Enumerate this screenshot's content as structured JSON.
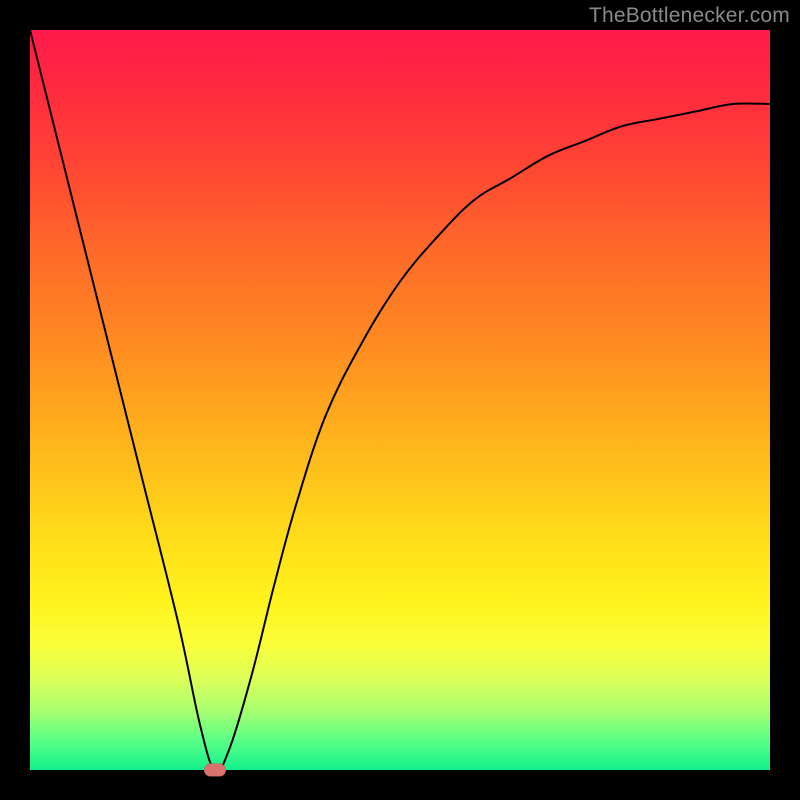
{
  "watermark": "TheBottlenecker.com",
  "chart_data": {
    "type": "line",
    "title": "",
    "xlabel": "",
    "ylabel": "",
    "xlim": [
      0,
      100
    ],
    "ylim": [
      0,
      100
    ],
    "series": [
      {
        "name": "bottleneck-curve",
        "x": [
          0,
          5,
          10,
          15,
          20,
          23,
          25,
          27,
          30,
          33,
          36,
          40,
          45,
          50,
          55,
          60,
          65,
          70,
          75,
          80,
          85,
          90,
          95,
          100
        ],
        "values": [
          100,
          80,
          60,
          40,
          20,
          6,
          0,
          3,
          13,
          25,
          36,
          48,
          58,
          66,
          72,
          77,
          80,
          83,
          85,
          87,
          88,
          89,
          90,
          90
        ]
      }
    ],
    "marker": {
      "x": 25,
      "y": 0
    },
    "gradient_stops": [
      {
        "pos": 0,
        "color": "#ff1a4b"
      },
      {
        "pos": 50,
        "color": "#ffb000"
      },
      {
        "pos": 80,
        "color": "#fff31c"
      },
      {
        "pos": 100,
        "color": "#13f08c"
      }
    ]
  }
}
